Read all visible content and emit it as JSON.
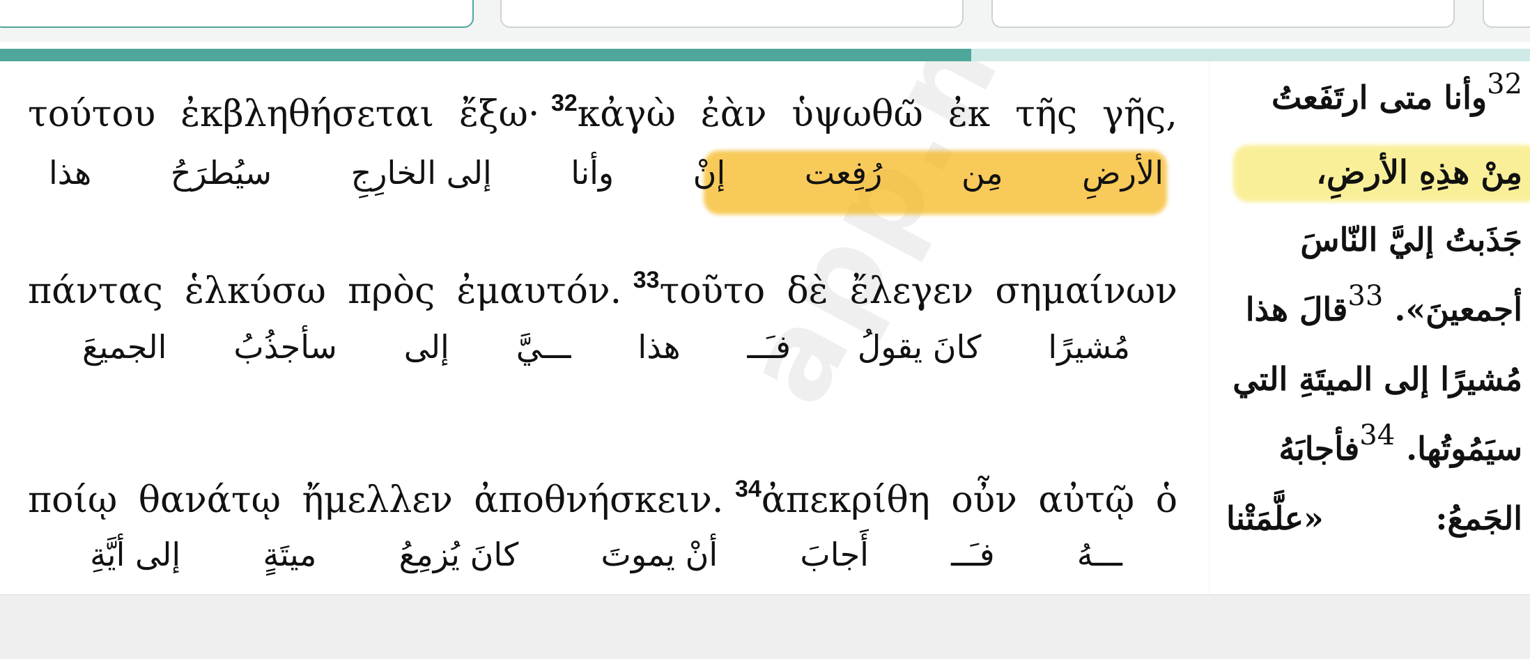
{
  "progress": {
    "fraction": 0.635
  },
  "watermark": "app.nas.l",
  "greek_lines": [
    {
      "segments": [
        "τούτου",
        "ἐκβληθήσεται",
        "ἔξω·"
      ],
      "verse": "32",
      "rest": [
        "κἀγὼ",
        "ἐὰν",
        "ὑψωθῶ",
        "ἐκ",
        "τῆς",
        "γῆς,"
      ]
    },
    {
      "segments": [
        "πάντας",
        "ἑλκύσω",
        "πρὸς",
        "ἐμαυτόν."
      ],
      "verse": "33",
      "rest": [
        "τοῦτο",
        "δὲ",
        "ἔλεγεν",
        "σημαίνων"
      ]
    },
    {
      "segments": [
        "ποίῳ",
        "θανάτῳ",
        "ἤμελλεν",
        "ἀποθνήσκειν."
      ],
      "verse": "34",
      "rest": [
        "ἀπεκρίθη",
        "οὖν",
        "αὐτῷ",
        "ὁ"
      ]
    }
  ],
  "arabic_lines": [
    [
      "هذا",
      "سيُطرَحُ",
      "إلى الخارِجِ",
      "وأنا",
      "إنْ",
      "رُفِعت",
      "مِن",
      "الأرضِ"
    ],
    [
      "الجميعَ",
      "سأجذُبُ",
      "إلى",
      "ـــيَّ",
      "هذا",
      "فـَــ",
      "كانَ يقولُ",
      "مُشيرًا"
    ],
    [
      "إلى أيَّةِ",
      "ميتَةٍ",
      "كانَ يُزمِعُ",
      "أنْ يموتَ",
      "أَجابَ",
      "فـَــ",
      "ـــهُ"
    ]
  ],
  "right_column": {
    "line1": {
      "num": "32",
      "text": "وأنا متى ارتَفَعتُ"
    },
    "line2": "مِنْ هذِهِ الأرضِ،",
    "line3": "جَذَبتُ إليَّ النّاسَ",
    "line4": {
      "a": "أجمعينَ».",
      "num": "33",
      "b": "قالَ هذا"
    },
    "line5": "مُشيرًا إلى الميتَةِ التي",
    "line6": {
      "a": "سيَمُوتُها.",
      "num": "34",
      "b": "فأجابَهُ"
    },
    "line7": {
      "a": "الجَمعُ:",
      "b": "«علَّمَتْنا"
    }
  }
}
